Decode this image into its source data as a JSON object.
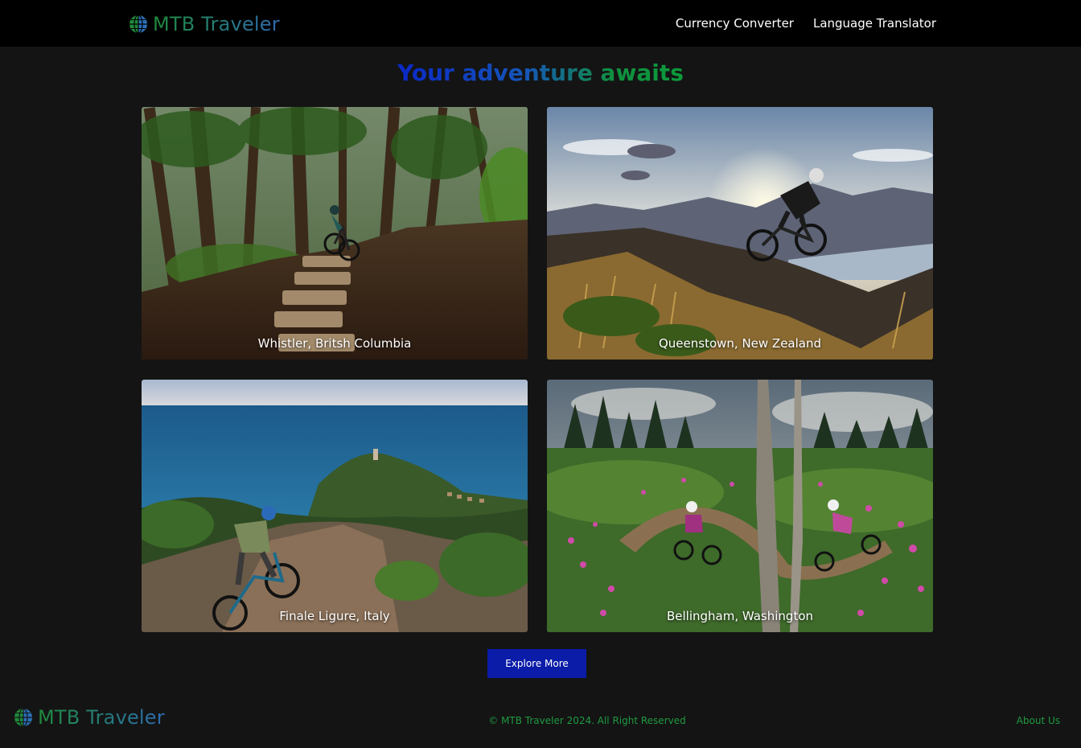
{
  "header": {
    "brand": "MTB Traveler",
    "nav": [
      "Currency Converter",
      "Language Translator"
    ]
  },
  "hero": {
    "title": "Your adventure awaits"
  },
  "destinations": [
    {
      "label": "Whistler, Britsh Columbia"
    },
    {
      "label": "Queenstown, New Zealand"
    },
    {
      "label": "Finale Ligure, Italy"
    },
    {
      "label": "Bellingham, Washington"
    }
  ],
  "cta": {
    "explore": "Explore More"
  },
  "footer": {
    "brand": "MTB Traveler",
    "copyright": "© MTB Traveler 2024. All Right Reserved",
    "about": "About Us"
  },
  "colors": {
    "navbar_bg": "#000000",
    "page_bg": "#141414",
    "button_bg": "#0a1ca8",
    "footer_text": "#1f9a40",
    "title_gradient_start": "#0a28c8",
    "title_gradient_end": "#0c9a3a"
  },
  "icons": {
    "brand_logo": "globe-icon"
  }
}
